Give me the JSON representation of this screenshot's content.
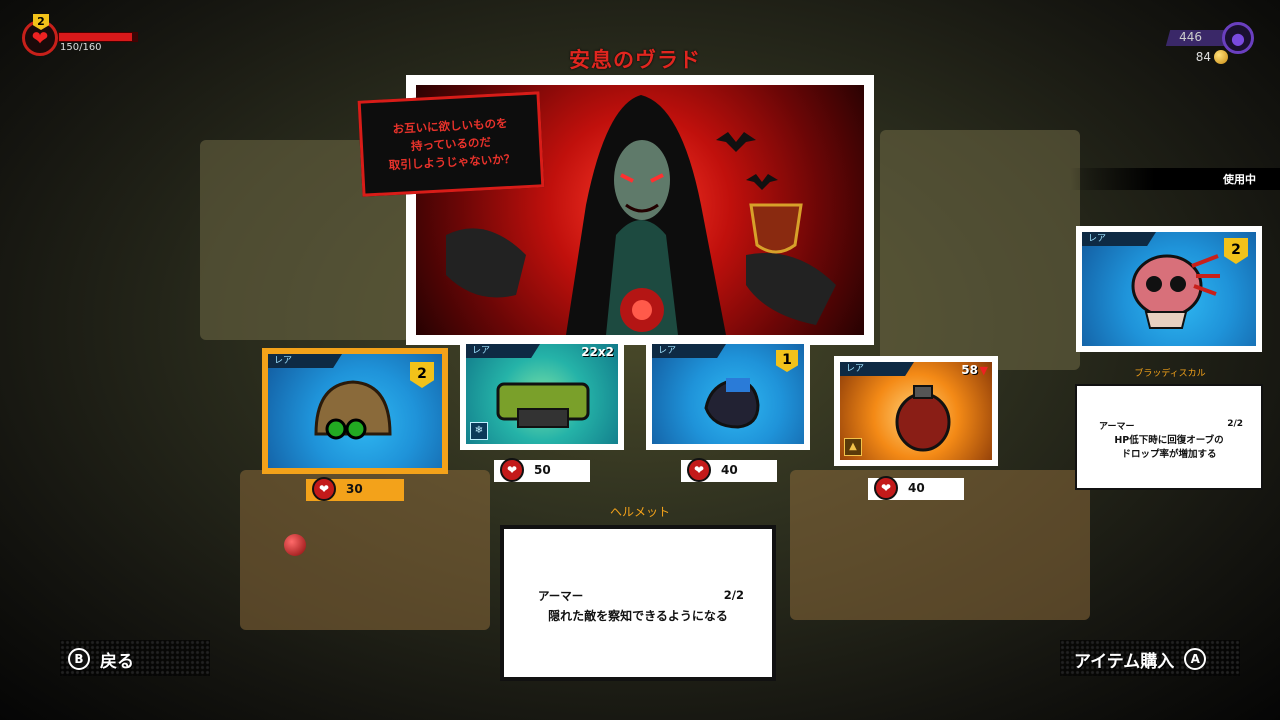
{
  "hud": {
    "player_level": "2",
    "hp_text": "150/160",
    "hp_fraction": 0.9375,
    "souls": "446",
    "gold": "84"
  },
  "merchant": {
    "name": "安息のヴラド",
    "speech_lines": [
      "お互いに欲しいものを",
      "持っているのだ",
      "取引しようじゃないか？"
    ]
  },
  "shop_items": [
    {
      "rarity": "レア",
      "badge": "2",
      "price": "30",
      "icon": "helmet-icon",
      "selected": true
    },
    {
      "rarity": "レア",
      "qty": "22x2",
      "price": "50",
      "icon": "minigun-icon",
      "corner_icon": "snowflake-icon"
    },
    {
      "rarity": "レア",
      "badge": "1",
      "price": "40",
      "icon": "glove-icon"
    },
    {
      "rarity": "レア",
      "qty": "58",
      "price": "40",
      "icon": "grenade-icon",
      "corner_icon": "flask-icon"
    }
  ],
  "description": {
    "title": "ヘルメット",
    "type": "アーマー",
    "count": "2/2",
    "text": "隠れた敵を察知できるようになる"
  },
  "equipped": {
    "header": "使用中",
    "rarity": "レア",
    "badge": "2",
    "name": "ブラッディスカル",
    "type": "アーマー",
    "count": "2/2",
    "lines": [
      "HP低下時に回復オーブの",
      "ドロップ率が増加する"
    ]
  },
  "buttons": {
    "back_key": "B",
    "back_label": "戻る",
    "buy_label": "アイテム購入",
    "buy_key": "A"
  },
  "colors": {
    "accent_red": "#e0261f",
    "selected_orange": "#f3a21a",
    "soul_purple": "#6a3fc0"
  }
}
